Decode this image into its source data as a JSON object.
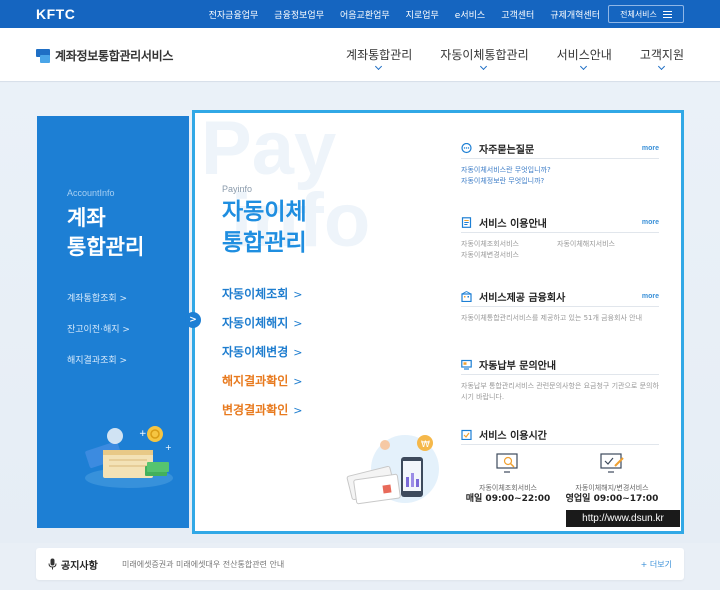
{
  "topbar": {
    "brand": "KFTC",
    "links": [
      "전자금융업무",
      "금융정보업무",
      "어음교환업무",
      "지로업무",
      "e서비스",
      "고객센터",
      "규제개혁센터"
    ],
    "all_services": "전체서비스"
  },
  "header": {
    "logo_text": "계좌정보통합관리서비스",
    "nav": [
      "계좌통합관리",
      "자동이체통합관리",
      "서비스안내",
      "고객지원"
    ]
  },
  "account_panel": {
    "subtitle": "AccountInfo",
    "title_line1": "계좌",
    "title_line2": "통합관리",
    "menu": [
      "계좌통합조회 >",
      "잔고이전·해지 >",
      "해지결과조회 >"
    ]
  },
  "pay_panel": {
    "bg_word_line1": "Pay",
    "bg_word_line2": "info",
    "subtitle": "Payinfo",
    "title_line1": "자동이체",
    "title_line2": "통합관리",
    "menu": [
      {
        "label": "자동이체조회",
        "color": "blue"
      },
      {
        "label": "자동이체해지",
        "color": "blue"
      },
      {
        "label": "자동이체변경",
        "color": "blue"
      },
      {
        "label": "해지결과확인",
        "color": "orange"
      },
      {
        "label": "변경결과확인",
        "color": "orange"
      }
    ],
    "menu_arrow": ">"
  },
  "sections": {
    "faq": {
      "title": "자주묻는질문",
      "more": "more",
      "items": [
        "자동이체서비스란 무엇입니까?",
        "자동이체정보란 무엇입니까?"
      ]
    },
    "usage": {
      "title": "서비스 이용안내",
      "more": "more",
      "items": [
        "자동이체조회서비스",
        "자동이체해지서비스",
        "자동이체변경서비스"
      ]
    },
    "providers": {
      "title": "서비스제공 금융회사",
      "more": "more",
      "text": "자동이체통합관리서비스를 제공하고 있는 51개 금융회사 안내"
    },
    "inquiry": {
      "title": "자동납부 문의안내",
      "text": "자동납부 통합관리서비스 관련문의사항은 요금청구 기관으로 문의하시기 바랍니다."
    },
    "hours": {
      "title": "서비스 이용시간",
      "col1_label": "자동이체조회서비스",
      "col1_time": "매일 09:00~22:00",
      "col2_label": "자동이체해지/변경서비스",
      "col2_time": "영업일 09:00~17:00"
    }
  },
  "watermark": "http://www.dsun.kr",
  "notice": {
    "title": "공지사항",
    "content": "미래에셋증권과 미래에셋대우 전산통합관련 안내",
    "more": "+ 더보기"
  },
  "colors": {
    "topbar": "#1565c0",
    "account_panel": "#1d7fd4",
    "pay_border": "#31a8e6",
    "pay_title": "#1f8ee0",
    "orange": "#e87a1e"
  }
}
